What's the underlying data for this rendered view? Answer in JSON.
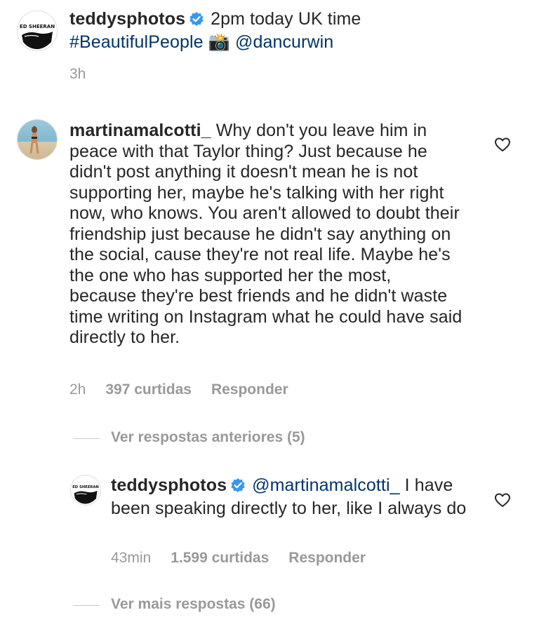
{
  "post": {
    "username": "teddysphotos",
    "caption_line1": "2pm today UK time",
    "hashtag": "#BeautifulPeople",
    "mention": "@dancurwin",
    "timestamp": "3h",
    "camera_emoji": "📸"
  },
  "comment": {
    "username": "martinamalcotti_",
    "text": "Why don't you leave him in peace with that Taylor thing? Just because he didn't post anything it doesn't mean he is not supporting her, maybe he's talking with her right now, who knows. You aren't allowed to doubt their friendship just because he didn't say anything on the social, cause they're not real life. Maybe he's the one who has supported her the most, because they're best friends and he didn't waste time writing on Instagram what he could have said directly to her.",
    "time": "2h",
    "likes": "397 curtidas",
    "reply_label": "Responder"
  },
  "view_previous": "Ver respostas anteriores (5)",
  "reply": {
    "username": "teddysphotos",
    "mention": "@martinamalcotti_",
    "text": "I have been speaking directly to her, like I always do",
    "time": "43min",
    "likes": "1.599 curtidas",
    "reply_label": "Responder"
  },
  "view_more": "Ver mais respostas (66)",
  "avatar_logo_text": "ED SHEERAN",
  "colors": {
    "text": "#262626",
    "meta": "#999999",
    "link": "#003569",
    "verified": "#3897f0"
  }
}
